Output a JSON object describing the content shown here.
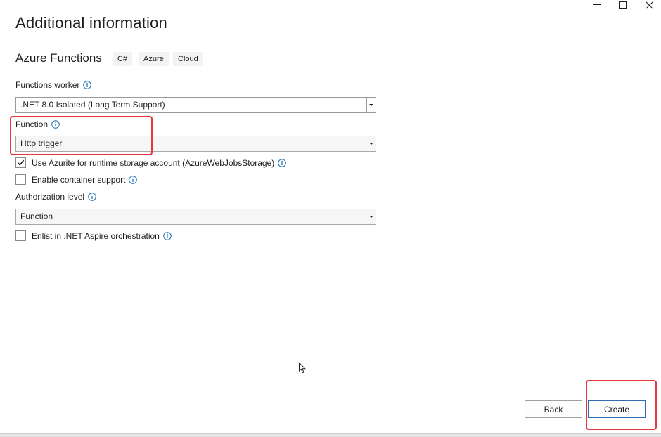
{
  "window": {
    "controls": [
      {
        "name": "minimize",
        "icon": "minimize-icon"
      },
      {
        "name": "maximize",
        "icon": "maximize-icon"
      },
      {
        "name": "close",
        "icon": "close-icon"
      }
    ]
  },
  "header": {
    "title": "Additional information",
    "subtitle": "Azure Functions",
    "tags": [
      "C#",
      "Azure",
      "Cloud"
    ]
  },
  "form": {
    "functions_worker": {
      "label": "Functions worker",
      "value": ".NET 8.0 Isolated (Long Term Support)"
    },
    "function": {
      "label": "Function",
      "value": "Http trigger"
    },
    "use_azurite": {
      "label": "Use Azurite for runtime storage account (AzureWebJobsStorage)",
      "checked": true
    },
    "enable_container": {
      "label": "Enable container support",
      "checked": false
    },
    "authorization_level": {
      "label": "Authorization level",
      "value": "Function"
    },
    "enlist_aspire": {
      "label": "Enlist in .NET Aspire orchestration",
      "checked": false
    }
  },
  "footer": {
    "back_label": "Back",
    "create_label": "Create"
  },
  "colors": {
    "accent": "#2f6bb7",
    "info_icon": "#1f6fb2",
    "highlight": "#e8383d"
  }
}
